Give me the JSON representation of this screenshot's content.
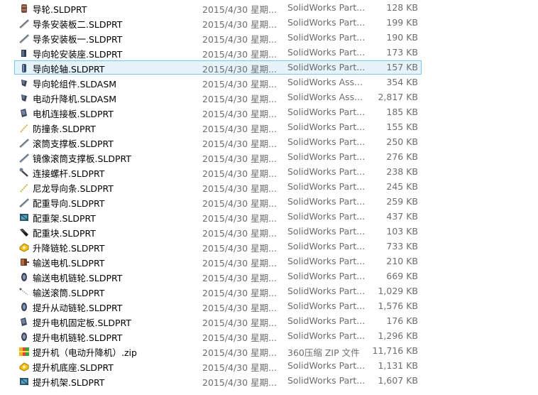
{
  "files": [
    {
      "name": "导轮.SLDPRT",
      "date": "2015/4/30 星期...",
      "type": "SolidWorks Part...",
      "size": "128 KB",
      "icon": "gear-part-icon"
    },
    {
      "name": "导条安装板二.SLDPRT",
      "date": "2015/4/30 星期...",
      "type": "SolidWorks Part...",
      "size": "199 KB",
      "icon": "rail-part-icon"
    },
    {
      "name": "导条安装板一.SLDPRT",
      "date": "2015/4/30 星期...",
      "type": "SolidWorks Part...",
      "size": "190 KB",
      "icon": "rail-part-icon"
    },
    {
      "name": "导向轮安装座.SLDPRT",
      "date": "2015/4/30 星期...",
      "type": "SolidWorks Part...",
      "size": "173 KB",
      "icon": "bracket-part-icon"
    },
    {
      "name": "导向轮轴.SLDPRT",
      "date": "2015/4/30 星期...",
      "type": "SolidWorks Part...",
      "size": "157 KB",
      "icon": "shaft-part-icon",
      "selected": true
    },
    {
      "name": "导向轮组件.SLDASM",
      "date": "2015/4/30 星期...",
      "type": "SolidWorks Ass...",
      "size": "354 KB",
      "icon": "assembly-icon"
    },
    {
      "name": "电动升降机.SLDASM",
      "date": "2015/4/30 星期...",
      "type": "SolidWorks Ass...",
      "size": "2,817 KB",
      "icon": "assembly-icon"
    },
    {
      "name": "电机连接板.SLDPRT",
      "date": "2015/4/30 星期...",
      "type": "SolidWorks Part...",
      "size": "185 KB",
      "icon": "plate-part-icon"
    },
    {
      "name": "防撞条.SLDPRT",
      "date": "2015/4/30 星期...",
      "type": "SolidWorks Part...",
      "size": "155 KB",
      "icon": "strip-part-icon"
    },
    {
      "name": "滚筒支撑板.SLDPRT",
      "date": "2015/4/30 星期...",
      "type": "SolidWorks Part...",
      "size": "250 KB",
      "icon": "rail-part-icon"
    },
    {
      "name": "镜像滚筒支撑板.SLDPRT",
      "date": "2015/4/30 星期...",
      "type": "SolidWorks Part...",
      "size": "276 KB",
      "icon": "rail-part-icon"
    },
    {
      "name": "连接螺杆.SLDPRT",
      "date": "2015/4/30 星期...",
      "type": "SolidWorks Part...",
      "size": "238 KB",
      "icon": "bolt-part-icon"
    },
    {
      "name": "尼龙导向条.SLDPRT",
      "date": "2015/4/30 星期...",
      "type": "SolidWorks Part...",
      "size": "245 KB",
      "icon": "strip-part-icon"
    },
    {
      "name": "配重导向.SLDPRT",
      "date": "2015/4/30 星期...",
      "type": "SolidWorks Part...",
      "size": "259 KB",
      "icon": "rail-part-icon"
    },
    {
      "name": "配重架.SLDPRT",
      "date": "2015/4/30 星期...",
      "type": "SolidWorks Part...",
      "size": "437 KB",
      "icon": "frame-part-icon"
    },
    {
      "name": "配重块.SLDPRT",
      "date": "2015/4/30 星期...",
      "type": "SolidWorks Part...",
      "size": "103 KB",
      "icon": "block-part-icon"
    },
    {
      "name": "升降链轮.SLDPRT",
      "date": "2015/4/30 星期...",
      "type": "SolidWorks Part...",
      "size": "733 KB",
      "icon": "yellow-part-icon"
    },
    {
      "name": "输送电机.SLDPRT",
      "date": "2015/4/30 星期...",
      "type": "SolidWorks Part...",
      "size": "210 KB",
      "icon": "motor-part-icon"
    },
    {
      "name": "输送电机链轮.SLDPRT",
      "date": "2015/4/30 星期...",
      "type": "SolidWorks Part...",
      "size": "669 KB",
      "icon": "sprocket-part-icon"
    },
    {
      "name": "输送滚筒.SLDPRT",
      "date": "2015/4/30 星期...",
      "type": "SolidWorks Part...",
      "size": "1,029 KB",
      "icon": "roller-part-icon"
    },
    {
      "name": "提升从动链轮.SLDPRT",
      "date": "2015/4/30 星期...",
      "type": "SolidWorks Part...",
      "size": "1,576 KB",
      "icon": "sprocket-part-icon"
    },
    {
      "name": "提升电机固定板.SLDPRT",
      "date": "2015/4/30 星期...",
      "type": "SolidWorks Part...",
      "size": "176 KB",
      "icon": "plate-part-icon"
    },
    {
      "name": "提升电机链轮.SLDPRT",
      "date": "2015/4/30 星期...",
      "type": "SolidWorks Part...",
      "size": "1,296 KB",
      "icon": "sprocket-part-icon"
    },
    {
      "name": "提升机（电动升降机）.zip",
      "date": "2015/4/30 星期...",
      "type": "360压缩 ZIP 文件",
      "size": "11,716 KB",
      "icon": "zip-archive-icon"
    },
    {
      "name": "提升机底座.SLDPRT",
      "date": "2015/4/30 星期...",
      "type": "SolidWorks Part...",
      "size": "1,131 KB",
      "icon": "yellow-part-icon"
    },
    {
      "name": "提升机架.SLDPRT",
      "date": "2015/4/30 星期...",
      "type": "SolidWorks Part...",
      "size": "1,607 KB",
      "icon": "frame-part-icon"
    }
  ],
  "colors": {
    "selection_bg": "#e5f3fb",
    "selection_border": "#7ec4ed",
    "secondary_text": "#6d6d6d"
  }
}
